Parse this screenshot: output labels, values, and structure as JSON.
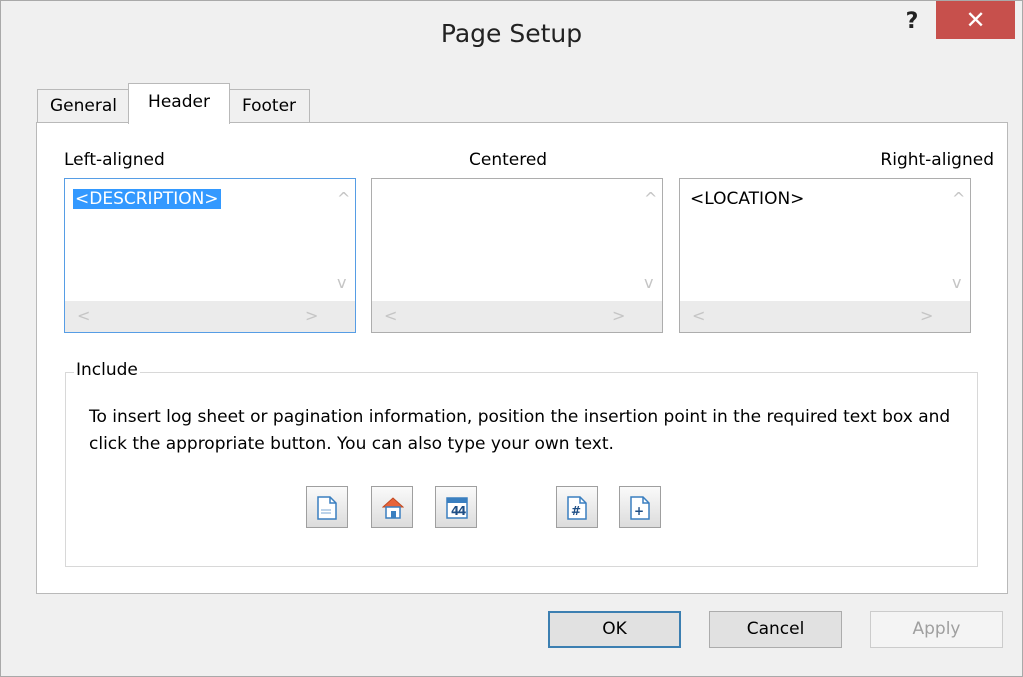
{
  "window": {
    "title": "Page Setup",
    "help_label": "?",
    "close_label": "✕"
  },
  "tabs": [
    {
      "label": "General",
      "active": false
    },
    {
      "label": "Header",
      "active": true
    },
    {
      "label": "Footer",
      "active": false
    }
  ],
  "header_panel": {
    "left": {
      "label": "Left-aligned",
      "value": "<DESCRIPTION>"
    },
    "center": {
      "label": "Centered",
      "value": ""
    },
    "right": {
      "label": "Right-aligned",
      "value": "<LOCATION>"
    }
  },
  "include": {
    "legend": "Include",
    "description": "To insert log sheet or pagination information, position the insertion point in the required text box and click the appropriate button. You can also type your own text.",
    "buttons": [
      {
        "icon": "page-icon"
      },
      {
        "icon": "house-icon"
      },
      {
        "icon": "calendar-icon"
      },
      {
        "icon": "page-number-icon"
      },
      {
        "icon": "page-count-icon"
      }
    ]
  },
  "footer_buttons": {
    "ok": "OK",
    "cancel": "Cancel",
    "apply": "Apply"
  },
  "scroll_glyphs": {
    "up": "^",
    "down": "v",
    "left": "<",
    "right": ">"
  },
  "colors": {
    "accent": "#3399ff",
    "close": "#c7504c",
    "focus_border": "#569de5"
  }
}
